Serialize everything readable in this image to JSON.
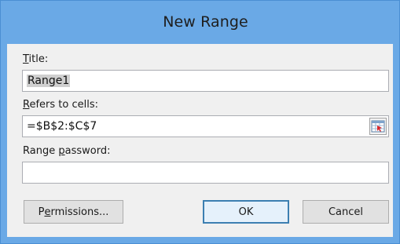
{
  "dialog": {
    "title": "New Range"
  },
  "title_field": {
    "label_hotkey": "T",
    "label_rest": "itle:",
    "value": "Range1"
  },
  "refers_field": {
    "label_hotkey": "R",
    "label_rest": "efers to cells:",
    "value": "=$B$2:$C$7",
    "collapse_icon": "range-select-icon"
  },
  "password_field": {
    "label_prefix": "Range ",
    "label_hotkey": "p",
    "label_rest": "assword:",
    "value": ""
  },
  "buttons": {
    "permissions_prefix": "P",
    "permissions_hotkey": "e",
    "permissions_rest": "rmissions...",
    "ok": "OK",
    "cancel": "Cancel"
  }
}
